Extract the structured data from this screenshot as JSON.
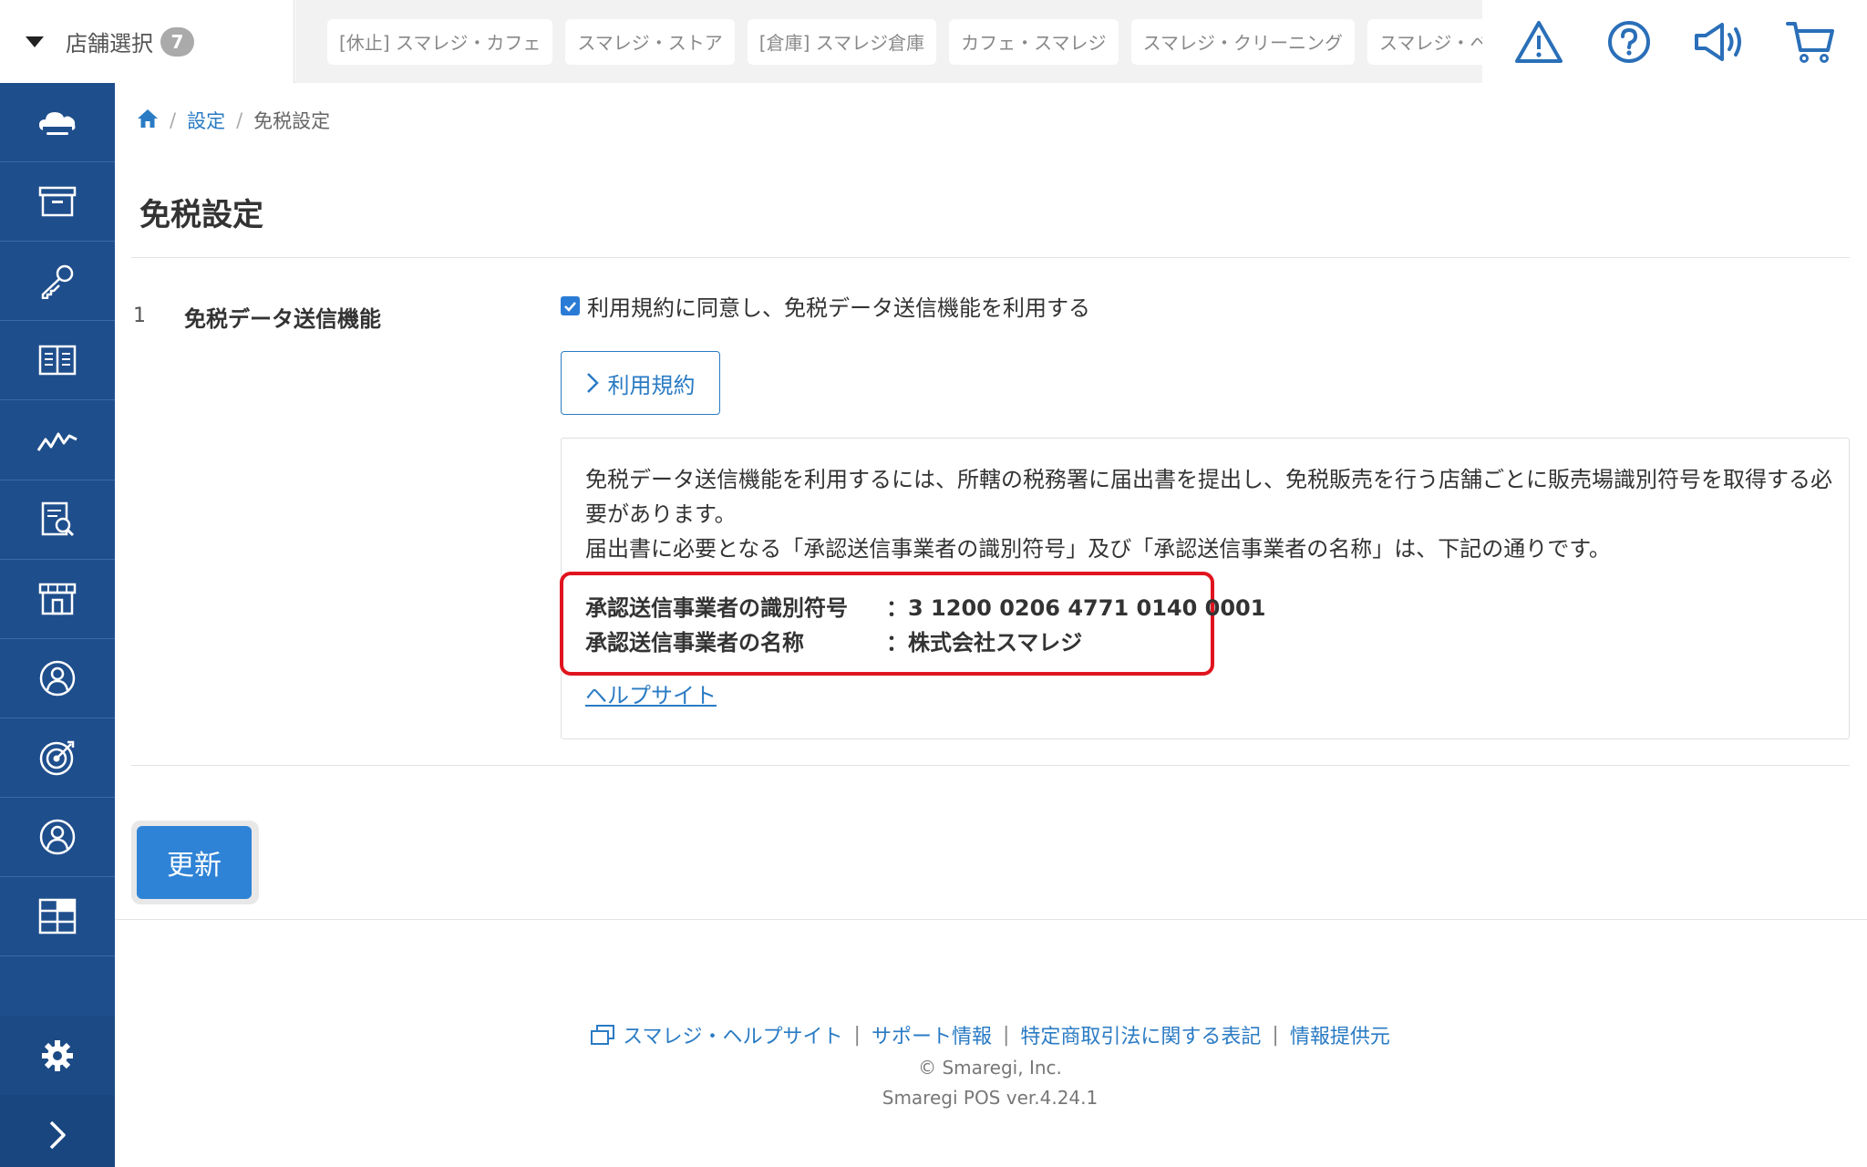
{
  "header": {
    "store_select_label": "店舗選択",
    "store_count": "7",
    "store_tabs": [
      "[休止] スマレジ・カフェ",
      "スマレジ・ストア",
      "[倉庫] スマレジ倉庫",
      "カフェ・スマレジ",
      "スマレジ・クリーニング",
      "スマレジ・ベー"
    ],
    "icons": [
      "warning-icon",
      "help-icon",
      "megaphone-icon",
      "cart-icon"
    ]
  },
  "sidebar": {
    "items": [
      "cloud-icon",
      "archive-box-icon",
      "key-icon",
      "book-icon",
      "chart-line-icon",
      "report-search-icon",
      "store-icon",
      "customer-icon",
      "target-icon",
      "user-icon",
      "apps-icon"
    ],
    "bottom": [
      "gear-icon",
      "chevron-right-icon"
    ]
  },
  "breadcrumb": {
    "home": "home",
    "settings": "設定",
    "current": "免税設定"
  },
  "page": {
    "title": "免税設定",
    "row_number": "1",
    "row_label": "免税データ送信機能",
    "agree_label": "利用規約に同意し、免税データ送信機能を利用する",
    "agree_checked": true,
    "terms_button": "利用規約",
    "info_line1": "免税データ送信機能を利用するには、所轄の税務署に届出書を提出し、免税販売を行う店舗ごとに販売場識別符号を取得する必要があります。",
    "info_line2": "届出書に必要となる「承認送信事業者の識別符号」及び「承認送信事業者の名称」は、下記の通りです。",
    "id_key": "承認送信事業者の識別符号",
    "id_value": "：3 1200 0206 4771 0140 0001",
    "name_key": "承認送信事業者の名称",
    "name_value": "：株式会社スマレジ",
    "help_link": "ヘルプサイト",
    "update_button": "更新",
    "highlight_color": "#e0141e"
  },
  "footer": {
    "links": [
      "スマレジ・ヘルプサイト",
      "サポート情報",
      "特定商取引法に関する表記",
      "情報提供元"
    ],
    "copyright": "© Smaregi, Inc.",
    "version": "Smaregi POS ver.4.24.1"
  },
  "colors": {
    "sidebar": "#1f4e8c",
    "accent": "#2a7bc4",
    "button": "#2f83d6"
  }
}
